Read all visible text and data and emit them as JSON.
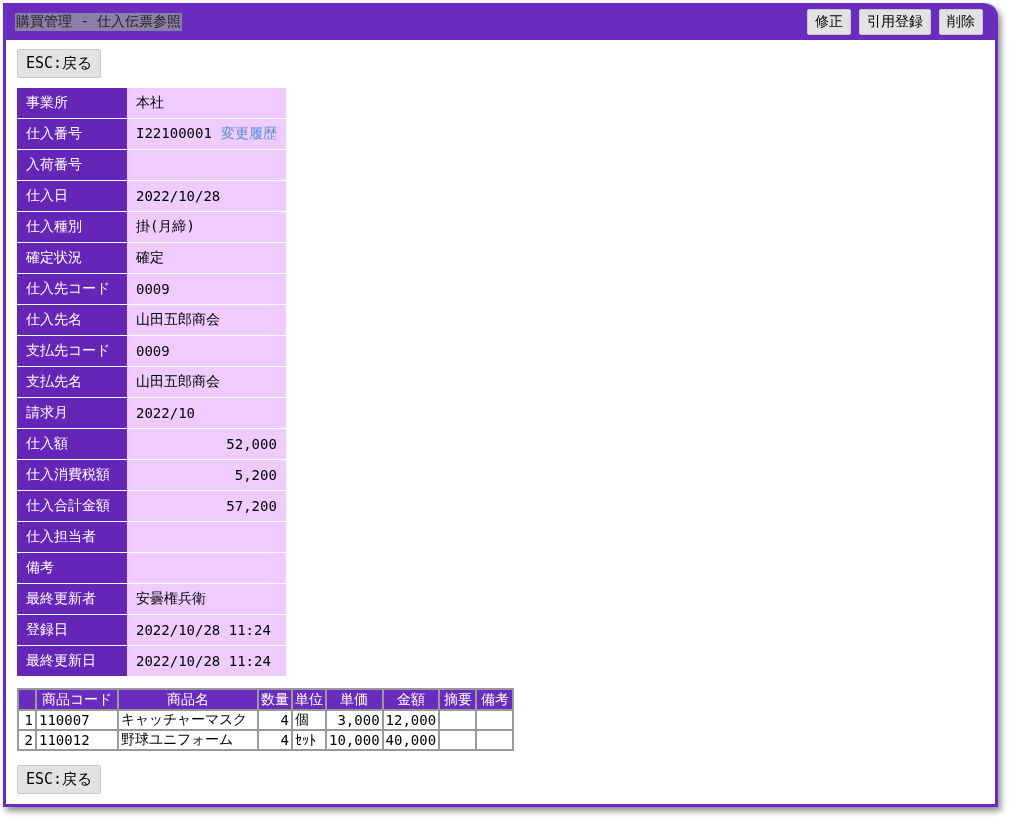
{
  "window": {
    "title": "購買管理 - 仕入伝票参照",
    "buttons": [
      "修正",
      "引用登録",
      "削除"
    ]
  },
  "back_buttons": [
    "ESC:戻る",
    "ESC:戻る"
  ],
  "fields": [
    {
      "label": "事業所",
      "value": "本社",
      "kind": "text"
    },
    {
      "label": "仕入番号",
      "value": "I22100001",
      "link": "変更履歴",
      "kind": "text"
    },
    {
      "label": "入荷番号",
      "kind": "text"
    },
    {
      "label": "仕入日",
      "value": "2022/10/28",
      "kind": "text"
    },
    {
      "label": "仕入種別",
      "value": "掛(月締)",
      "kind": "text"
    },
    {
      "label": "確定状況",
      "value": "確定",
      "kind": "text"
    },
    {
      "label": "仕入先コード",
      "value": "0009",
      "kind": "text"
    },
    {
      "label": "仕入先名",
      "value": "山田五郎商会",
      "kind": "text"
    },
    {
      "label": "支払先コード",
      "value": "0009",
      "kind": "text"
    },
    {
      "label": "支払先名",
      "value": "山田五郎商会",
      "kind": "text"
    },
    {
      "label": "請求月",
      "value": "2022/10",
      "kind": "text"
    },
    {
      "label": "仕入額",
      "value": "52,000",
      "kind": "amount"
    },
    {
      "label": "仕入消費税額",
      "value": "5,200",
      "kind": "amount"
    },
    {
      "label": "仕入合計金額",
      "value": "57,200",
      "kind": "amount"
    },
    {
      "label": "仕入担当者",
      "kind": "text"
    },
    {
      "label": "備考",
      "kind": "text"
    },
    {
      "label": "最終更新者",
      "value": "安曇権兵衛",
      "kind": "text"
    },
    {
      "label": "登録日",
      "value": "2022/10/28 11:24",
      "kind": "text"
    },
    {
      "label": "最終更新日",
      "value": "2022/10/28 11:24",
      "kind": "text"
    }
  ],
  "table": {
    "columns": [
      {
        "kind": "number"
      },
      {
        "label": "商品コード",
        "kind": "text"
      },
      {
        "label": "商品名",
        "kind": "text"
      },
      {
        "label": "数量",
        "kind": "number"
      },
      {
        "label": "単位",
        "kind": "text"
      },
      {
        "label": "単価",
        "kind": "number"
      },
      {
        "label": "金額",
        "kind": "number"
      },
      {
        "label": "摘要",
        "kind": "text"
      },
      {
        "label": "備考",
        "kind": "text"
      }
    ],
    "rows": [
      [
        "1",
        "110007",
        "キャッチャーマスク",
        "4",
        "個",
        "3,000",
        "12,000",
        "",
        ""
      ],
      [
        "2",
        "110012",
        "野球ユニフォーム",
        "4",
        "ｾｯﾄ",
        "10,000",
        "40,000",
        "",
        ""
      ]
    ]
  }
}
